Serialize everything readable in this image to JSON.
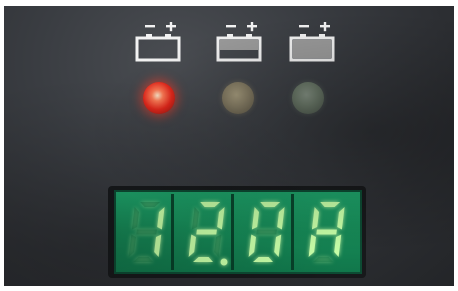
{
  "charger_panel": {
    "battery_icons": [
      {
        "name": "battery-charging-icon",
        "state": "empty"
      },
      {
        "name": "battery-half-icon",
        "state": "half"
      },
      {
        "name": "battery-full-icon",
        "state": "full"
      }
    ],
    "leds": [
      {
        "color": "#e5281c",
        "lit": true
      },
      {
        "color": "#857c64",
        "lit": false
      },
      {
        "color": "#6a7868",
        "lit": false
      }
    ],
    "display": {
      "reading": "12.0A",
      "digits": [
        "1",
        "2",
        "0",
        "A"
      ],
      "decimal_after_index": 1,
      "segment_color": "#c7ffa8",
      "background_color": "#178b58"
    }
  }
}
